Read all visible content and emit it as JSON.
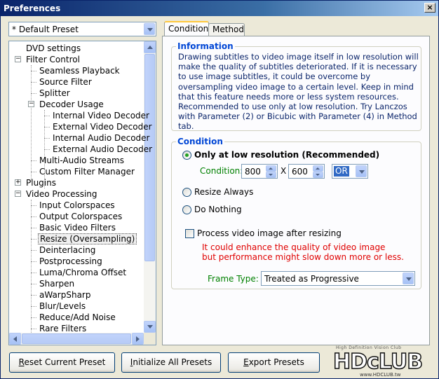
{
  "window": {
    "title": "Preferences",
    "close_glyph": "×"
  },
  "preset": {
    "selected": "* Default Preset"
  },
  "tree": {
    "items": [
      {
        "label": "DVD settings"
      },
      {
        "label": "Filter Control",
        "expander": "−"
      },
      {
        "label": "Seamless Playback"
      },
      {
        "label": "Source Filter"
      },
      {
        "label": "Splitter"
      },
      {
        "label": "Decoder Usage",
        "expander": "−"
      },
      {
        "label": "Internal Video Decoder"
      },
      {
        "label": "External Video Decoder"
      },
      {
        "label": "Internal Audio Decoder"
      },
      {
        "label": "External Audio Decoder"
      },
      {
        "label": "Multi-Audio Streams"
      },
      {
        "label": "Custom Filter Manager"
      },
      {
        "label": "Plugins",
        "expander": "+"
      },
      {
        "label": "Video Processing",
        "expander": "−"
      },
      {
        "label": "Input Colorspaces"
      },
      {
        "label": "Output Colorspaces"
      },
      {
        "label": "Basic Video Filters"
      },
      {
        "label": "Resize (Oversampling)",
        "selected": true
      },
      {
        "label": "Deinterlacing"
      },
      {
        "label": "Postprocessing"
      },
      {
        "label": "Luma/Chroma Offset"
      },
      {
        "label": "Sharpen"
      },
      {
        "label": "aWarpSharp"
      },
      {
        "label": "Blur/Levels"
      },
      {
        "label": "Reduce/Add Noise"
      },
      {
        "label": "Rare Filters"
      }
    ]
  },
  "tabs": [
    {
      "label": "Condition",
      "active": true
    },
    {
      "label": "Method",
      "active": false
    }
  ],
  "information": {
    "title": "Information",
    "text": "Drawing subtitles to video image itself in low resolution will make the quality of subtitles deteriorated. If it is necessary to use image subtitles, it could be overcome by oversampling video image to a certain level. Keep in mind that this feature needs more or less system resources. Recommended to use only at low resolution. Try Lanczos with Parameter (2) or Bicubic with Parameter (4) in Method tab."
  },
  "condition": {
    "title": "Condition",
    "option_low_res": "Only at low resolution (Recommended)",
    "condition_label": "Condition:",
    "width": "800",
    "x_sep": "X",
    "height": "600",
    "logic": "OR",
    "option_always": "Resize Always",
    "option_nothing": "Do Nothing",
    "process_after_label": "Process video image after resizing",
    "warning_line1": "It could enhance the quality of video image",
    "warning_line2": "but performance might slow down more or less.",
    "frame_type_label": "Frame Type:",
    "frame_type_value": "Treated as Progressive"
  },
  "buttons": {
    "reset_pre": "",
    "reset_u": "R",
    "reset_post": "eset Current Preset",
    "init_pre": "",
    "init_u": "I",
    "init_post": "nitialize All Presets",
    "export_pre": "",
    "export_u": "E",
    "export_post": "xport Presets"
  },
  "watermark": {
    "tagline": "High Definition Vision Club",
    "brand": "HDcLUB",
    "domain": "www.HDCLUB.tw"
  },
  "colors": {
    "titlebar": "#0a246a",
    "accent_blue": "#0046d5",
    "warning_red": "#e00000",
    "condition_green": "#008000",
    "selection": "#316ac5"
  }
}
